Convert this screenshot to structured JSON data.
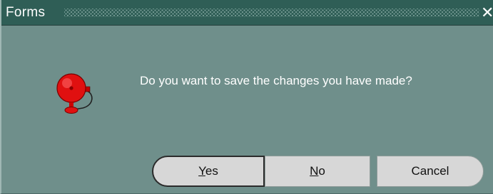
{
  "window": {
    "title": "Forms",
    "close_glyph": "✕"
  },
  "icon": {
    "name": "alarm-bell-icon",
    "color": "#e01010"
  },
  "message": "Do you want to save the changes you have made?",
  "buttons": {
    "yes": {
      "mnemonic": "Y",
      "rest": "es"
    },
    "no": {
      "mnemonic": "N",
      "rest": "o"
    },
    "cancel": {
      "label": "Cancel"
    }
  },
  "colors": {
    "dialog_bg": "#6f8f8b",
    "titlebar_bg": "#2f5e56",
    "button_bg": "#d7d7d7",
    "text_light": "#ffffff"
  }
}
